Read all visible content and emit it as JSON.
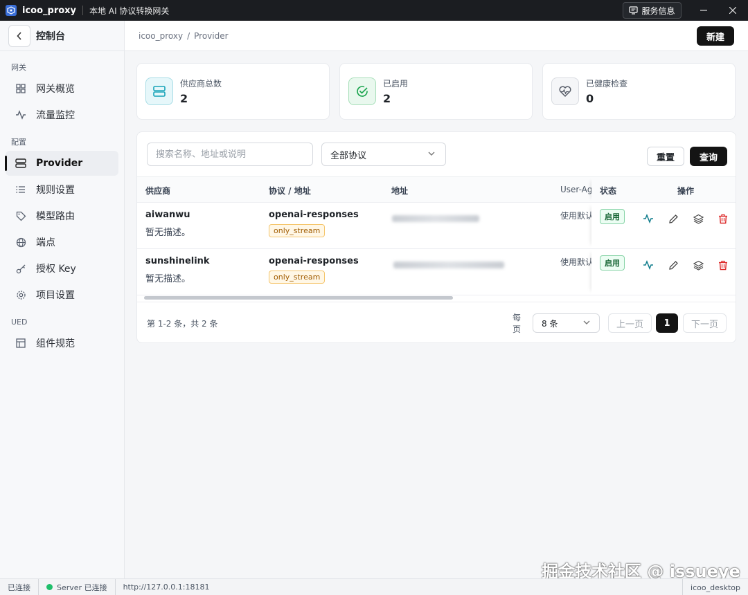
{
  "titlebar": {
    "app_name": "icoo_proxy",
    "subtitle": "本地 AI 协议转换网关",
    "service_info": "服务信息"
  },
  "sidebar": {
    "title": "控制台",
    "sections": [
      {
        "label": "网关"
      },
      {
        "label": "配置"
      },
      {
        "label": "UED"
      }
    ],
    "items": [
      {
        "label": "网关概览",
        "icon": "grid-icon"
      },
      {
        "label": "流量监控",
        "icon": "activity-icon"
      },
      {
        "label": "Provider",
        "icon": "server-icon",
        "active": true
      },
      {
        "label": "规则设置",
        "icon": "list-icon"
      },
      {
        "label": "模型路由",
        "icon": "tag-icon"
      },
      {
        "label": "端点",
        "icon": "globe-icon"
      },
      {
        "label": "授权 Key",
        "icon": "key-icon"
      },
      {
        "label": "项目设置",
        "icon": "gear-icon"
      },
      {
        "label": "组件规范",
        "icon": "layout-icon"
      }
    ]
  },
  "header": {
    "breadcrumb": [
      "icoo_proxy",
      "/",
      "Provider"
    ],
    "new_button": "新建"
  },
  "stats": [
    {
      "label": "供应商总数",
      "value": "2",
      "icon": "server-icon",
      "color": "#16a3b8"
    },
    {
      "label": "已启用",
      "value": "2",
      "icon": "check-circle-icon",
      "color": "#16a34a"
    },
    {
      "label": "已健康检查",
      "value": "0",
      "icon": "heart-pulse-icon",
      "color": "#555b66"
    }
  ],
  "filters": {
    "search_placeholder": "搜索名称、地址或说明",
    "protocol_select": "全部协议",
    "reset": "重置",
    "query": "查询"
  },
  "table": {
    "columns": [
      "供应商",
      "协议 / 地址",
      "地址",
      "User-Ag",
      "状态",
      "操作"
    ],
    "rows": [
      {
        "name": "aiwanwu",
        "desc": "暂无描述。",
        "protocol": "openai-responses",
        "tag": "only_stream",
        "user_agent": "使用默认",
        "status": "启用"
      },
      {
        "name": "sunshinelink",
        "desc": "暂无描述。",
        "protocol": "openai-responses",
        "tag": "only_stream",
        "user_agent": "使用默认",
        "status": "启用"
      }
    ]
  },
  "pagination": {
    "total_text": "第 1-2 条，共 2 条",
    "per_page_label": "每页",
    "per_page": "8 条",
    "prev": "上一页",
    "current": "1",
    "next": "下一页"
  },
  "statusbar": {
    "connection": "已连接",
    "server": "Server 已连接",
    "url": "http://127.0.0.1:18181",
    "app": "icoo_desktop"
  },
  "watermark": "掘金技术社区 @ issueye"
}
